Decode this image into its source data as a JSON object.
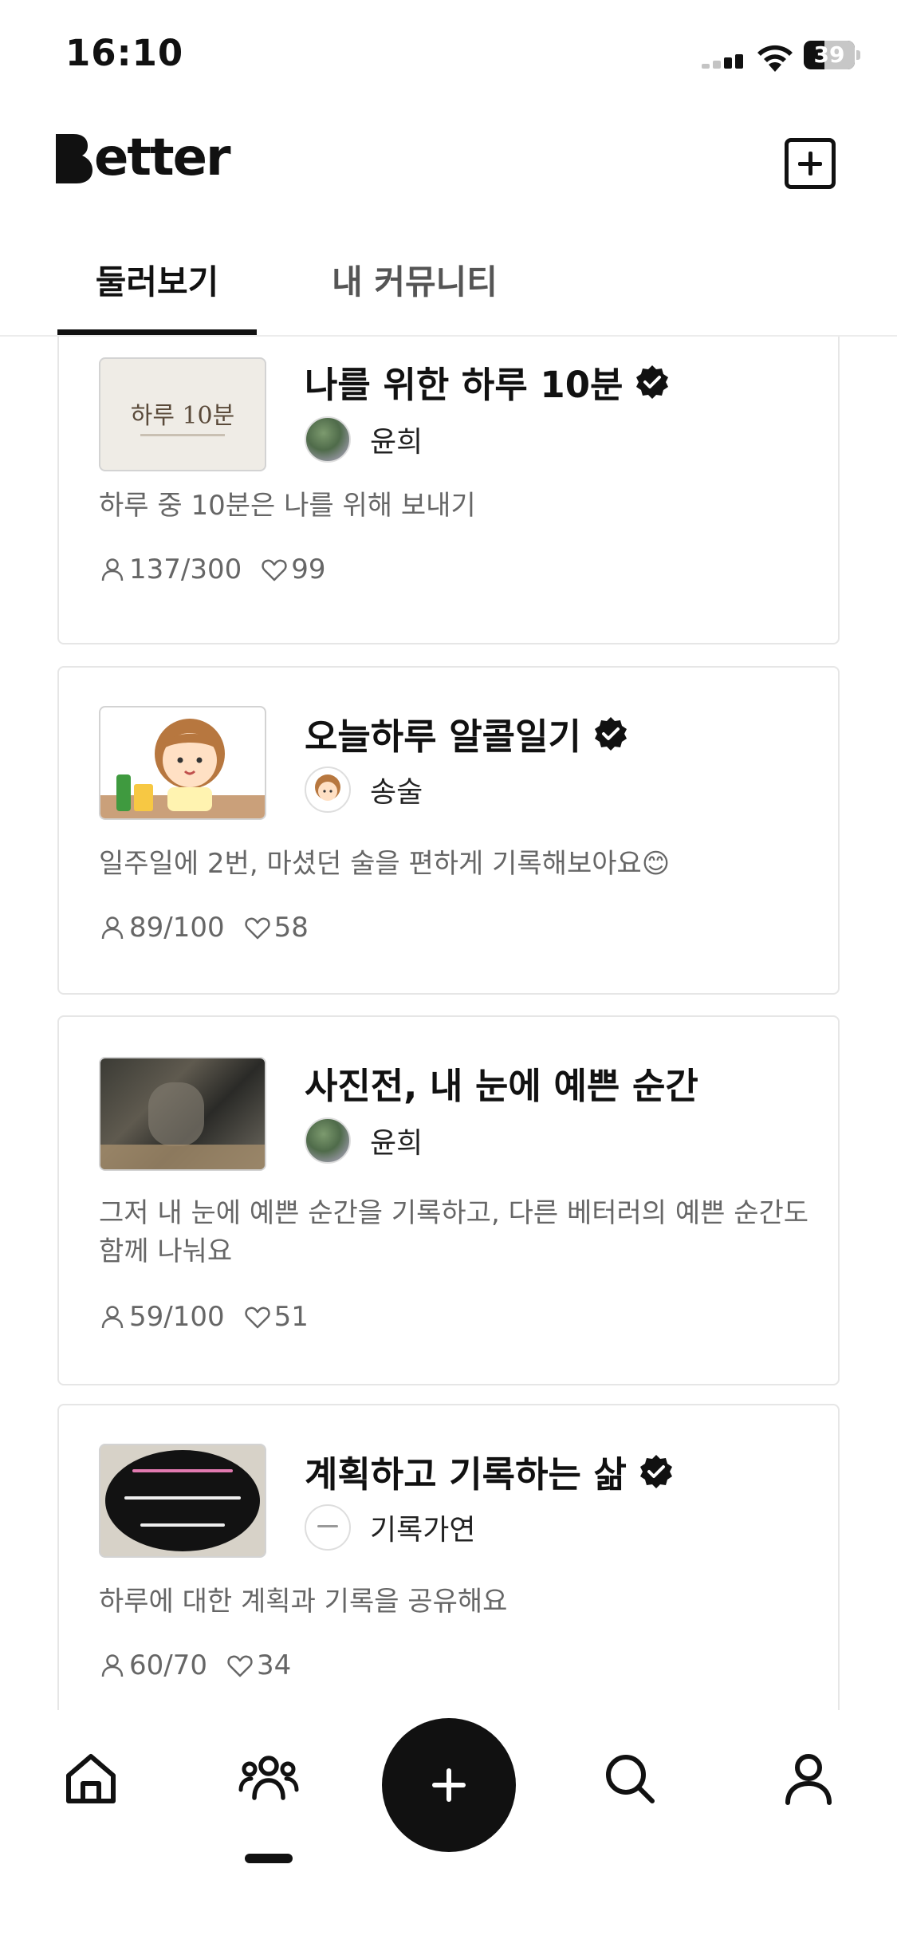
{
  "status_bar": {
    "time": "16:10",
    "battery": "39"
  },
  "header": {
    "logo": "Better"
  },
  "tabs": [
    {
      "label": "둘러보기",
      "active": true
    },
    {
      "label": "내 커뮤니티",
      "active": false
    }
  ],
  "communities": [
    {
      "title": "나를 위한 하루 10분",
      "verified": true,
      "owner": "윤희",
      "description": "하루 중 10분은 나를 위해 보내기",
      "members": "137/300",
      "likes": "99",
      "thumb_text": "하루 10분"
    },
    {
      "title": "오늘하루 알콜일기",
      "verified": true,
      "owner": "송술",
      "description": "일주일에 2번, 마셨던 술을 편하게 기록해보아요😊",
      "members": "89/100",
      "likes": "58"
    },
    {
      "title": "사진전, 내 눈에 예쁜 순간",
      "verified": false,
      "owner": "윤희",
      "description": "그저 내 눈에 예쁜 순간을 기록하고, 다른 베터러의 예쁜 순간도 함께 나눠요",
      "members": "59/100",
      "likes": "51"
    },
    {
      "title": "계획하고 기록하는 삶",
      "verified": true,
      "owner": "기록가연",
      "description": "하루에 대한 계획과 기록을 공유해요",
      "members": "60/70",
      "likes": "34"
    }
  ],
  "bottom_nav": [
    {
      "icon": "home-icon"
    },
    {
      "icon": "community-icon",
      "active": true
    },
    {
      "icon": "plus-icon"
    },
    {
      "icon": "search-icon"
    },
    {
      "icon": "profile-icon"
    }
  ],
  "colors": {
    "primary": "#111111",
    "muted_text": "#666666",
    "border": "#e6e6e6"
  }
}
